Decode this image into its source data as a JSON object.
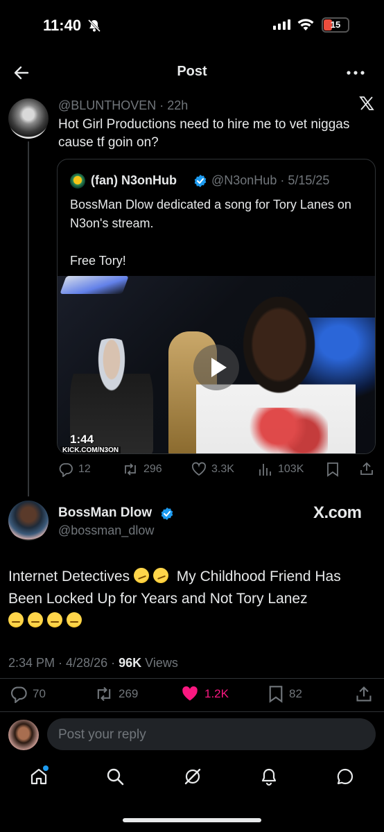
{
  "status_bar": {
    "time": "11:40",
    "battery": "15"
  },
  "header": {
    "title": "Post"
  },
  "parent_tweet": {
    "handle_time": "@BLUNTHOVEN · 22h",
    "text": "Hot Girl Productions need to hire me to vet niggas cause tf goin on?",
    "quote": {
      "name": "(fan) N3onHub",
      "handle_date": "@N3onHub · 5/15/25",
      "text": "BossMan Dlow dedicated a song for Tory Lanes on N3on's stream.\n\nFree Tory!",
      "video": {
        "duration": "1:44",
        "watermark": "KICK.COM/N3ON"
      }
    },
    "actions": {
      "replies": "12",
      "reposts": "296",
      "likes": "3.3K",
      "views": "103K"
    }
  },
  "main_tweet": {
    "name": "BossMan Dlow",
    "handle": "@bossman_dlow",
    "source_logo": "X.com",
    "text_part1": "Internet Detectives",
    "text_part2": "My Childhood Friend Has Been Locked Up for Years and Not Tory Lanez",
    "timestamp": "2:34 PM · 4/28/26 ·",
    "views_count": "96K",
    "views_label": "Views",
    "actions": {
      "replies": "70",
      "reposts": "269",
      "likes": "1.2K",
      "bookmarks": "82"
    },
    "like_color": "#f91880"
  },
  "reply": {
    "placeholder": "Post your reply"
  },
  "bottom_nav": [
    "home-icon",
    "search-icon",
    "grok-icon",
    "notifications-icon",
    "messages-icon"
  ]
}
